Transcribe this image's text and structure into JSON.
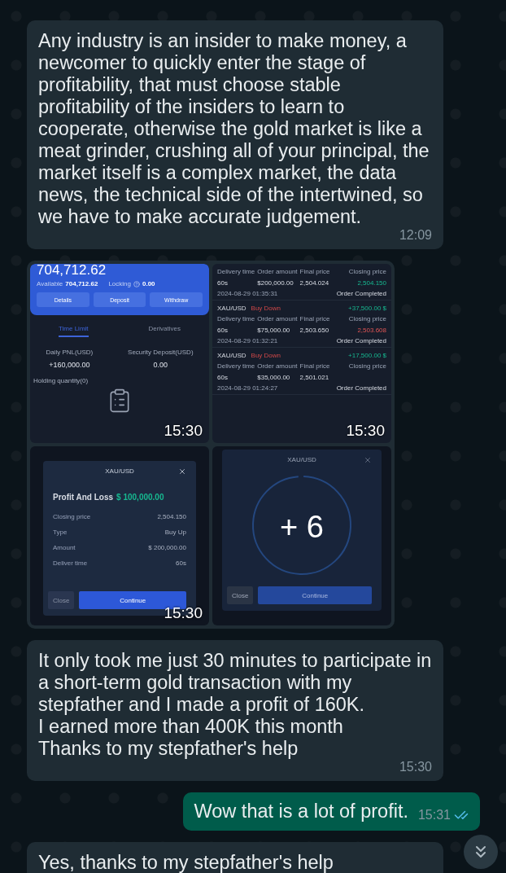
{
  "messages": [
    {
      "kind": "text",
      "outgoing": false,
      "text": "Any industry is an insider to make money, a newcomer to quickly enter the stage of profitability, that must choose stable profitability of the insiders to learn to cooperate, otherwise the gold market is like a meat grinder, crushing all of your principal, the market itself is a complex market, the data news, the technical side of the intertwined, so we have to make accurate judgement.",
      "time": "12:09"
    },
    {
      "kind": "album",
      "outgoing": false,
      "images": [
        {
          "kind": "wallet",
          "time": "15:30",
          "balance": "704,712.62",
          "available_label": "Available",
          "available": "704,712.62",
          "locking_label": "Locking",
          "locking": "0.00",
          "buttons": [
            "Details",
            "Deposit",
            "Withdraw"
          ],
          "tabs": [
            {
              "label": "Time Limit",
              "selected": true
            },
            {
              "label": "Derivatives",
              "selected": false
            }
          ],
          "stats": [
            {
              "label": "Daily PNL(USD)",
              "value": "+160,000.00"
            },
            {
              "label": "Security Deposit(USD)",
              "value": "0.00"
            }
          ],
          "holding": "Holding quantity(0)"
        },
        {
          "kind": "orders",
          "time": "15:30",
          "orders": [
            {
              "columns": [
                "Delivery time",
                "Order amount",
                "Final price",
                "Closing price"
              ],
              "values": [
                "60s",
                "$200,000.00",
                "2,504.024",
                "2,504.150"
              ],
              "rising": true,
              "date": "2024-08-29 01:35:31",
              "status": "Order Completed"
            },
            {
              "pair": "XAU/USD",
              "side": "Buy Down",
              "profit": "+37,500.00 $",
              "columns": [
                "Delivery time",
                "Order amount",
                "Final price",
                "Closing price"
              ],
              "values": [
                "60s",
                "$75,000.00",
                "2,503.650",
                "2,503.608"
              ],
              "rising": false,
              "date": "2024-08-29 01:32:21",
              "status": "Order Completed"
            },
            {
              "pair": "XAU/USD",
              "side": "Buy Down",
              "profit": "+17,500.00 $",
              "columns": [
                "Delivery time",
                "Order amount",
                "Final price",
                "Closing price"
              ],
              "values": [
                "60s",
                "$35,000.00",
                "2,501.021"
              ],
              "date": "2024-08-29 01:24:27",
              "status": "Order Completed"
            }
          ]
        },
        {
          "kind": "result",
          "time": "15:30",
          "title": "XAU/USD",
          "heading": "Profit And Loss",
          "amount": "$ 100,000.00",
          "rows": [
            {
              "label": "Closing price",
              "value": "2,504.150"
            },
            {
              "label": "Type",
              "value": "Buy Up"
            },
            {
              "label": "Amount",
              "value": "$ 200,000.00"
            },
            {
              "label": "Deliver time",
              "value": "60s"
            }
          ],
          "buttons": [
            "Close",
            "Continue"
          ]
        },
        {
          "kind": "timer",
          "title": "XAU/USD",
          "buttons": [
            "Close",
            "Continue"
          ],
          "more": "+ 6"
        }
      ]
    },
    {
      "kind": "text",
      "outgoing": false,
      "text": "It only took me just 30 minutes to participate in a short-term gold transaction with my stepfather and I made a profit of 160K.\nI earned more than 400K this month\nThanks to my stepfather's help",
      "time": "15:30"
    },
    {
      "kind": "text",
      "outgoing": true,
      "text": "Wow that is a lot of profit.",
      "time": "15:31",
      "read": true
    },
    {
      "kind": "text",
      "outgoing": false,
      "text": "Yes, thanks to my stepfather's help"
    }
  ]
}
